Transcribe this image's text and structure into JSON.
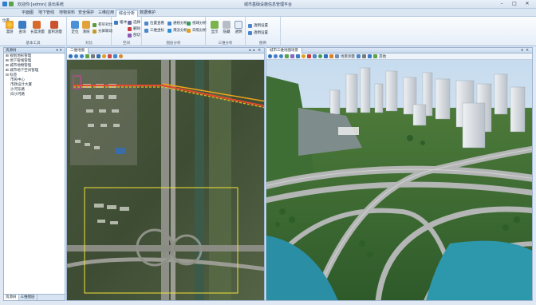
{
  "titlebar": {
    "user": "欢迎你:[admin] 退出系统",
    "title": "城市基础设施信息管理平台",
    "minimize": "–",
    "maximize": "□",
    "close": "✕"
  },
  "tabs": [
    "平面图",
    "地下管线",
    "地物资料",
    "安全保护",
    "三维应用",
    "综合分析",
    "数据维护"
  ],
  "active_tab": "综合分析",
  "ribbon": {
    "left_label": "位置",
    "groups": [
      {
        "label": "基本工具",
        "buttons": [
          "漫游",
          "查询",
          "长度测量",
          "面积测量"
        ]
      },
      {
        "label": "对比",
        "buttons": [
          "定位",
          "清除",
          "卷帘对比",
          "分屏联动"
        ]
      },
      {
        "label": "空间",
        "buttons": [
          "缓冲",
          "选择",
          "删除",
          "剖切"
        ]
      },
      {
        "label": "图层分析",
        "buttons": [
          "位置查看",
          "通视分析",
          "视域分析",
          "三维坐标",
          "淹没分析",
          "日照分析"
        ]
      },
      {
        "label": "三维分析",
        "buttons": [
          "显示",
          "隐藏",
          "透明"
        ]
      },
      {
        "label": "图例",
        "buttons": [
          "透明设置",
          "透明设置"
        ]
      }
    ]
  },
  "left_panel": {
    "title": "资源树",
    "close": "▾ ✕",
    "tree": [
      {
        "label": "⊞ 规划地形管理",
        "level": 0
      },
      {
        "label": "⊞ 地下管线管理",
        "level": 0
      },
      {
        "label": "⊞ 城市地物管理",
        "level": 0
      },
      {
        "label": "⊞ 城市地下空间管理",
        "level": 0
      },
      {
        "label": "⊟ 标签",
        "level": 0
      },
      {
        "label": "市民中心",
        "level": 1
      },
      {
        "label": "市政设计大厦",
        "level": 1
      },
      {
        "label": "沙河东路",
        "level": 1
      },
      {
        "label": "白沙河路",
        "level": 1
      }
    ],
    "footer_tabs": [
      "资源树",
      "三维图层"
    ]
  },
  "pane2d": {
    "title": "二维地图",
    "controls": "◂ ▸ ✕"
  },
  "pane3d": {
    "title": "城市三维地图场景",
    "tools_label": "场景测量",
    "more_label": "其他",
    "controls": "▾ ✕"
  }
}
